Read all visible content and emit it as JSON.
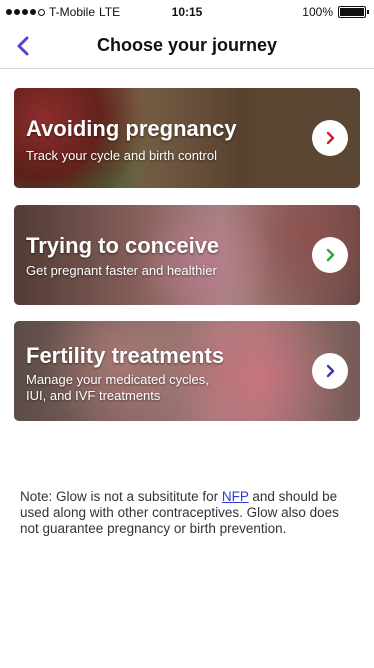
{
  "status": {
    "carrier": "T-Mobile",
    "network": "LTE",
    "time": "10:15",
    "battery": "100%",
    "battery_level": 1.0
  },
  "nav": {
    "back_icon": "chevron-left-icon",
    "title": "Choose your journey",
    "accent_color": "#5b3fd1"
  },
  "journeys": [
    {
      "title": "Avoiding pregnancy",
      "subtitle": "Track your cycle and birth control",
      "arrow_color": "#d0202a",
      "arrow_icon": "chevron-right-icon"
    },
    {
      "title": "Trying to conceive",
      "subtitle": "Get pregnant faster and healthier",
      "arrow_color": "#2da832",
      "arrow_icon": "chevron-right-icon"
    },
    {
      "title": "Fertility treatments",
      "subtitle_line1": "Manage your medicated cycles,",
      "subtitle_line2": "IUI, and IVF treatments",
      "arrow_color": "#4a2fb5",
      "arrow_icon": "chevron-right-icon"
    }
  ],
  "note": {
    "prefix": "Note: Glow is not a subsititute for ",
    "link": "NFP",
    "suffix": " and should be used along with other contraceptives. Glow also does not guarantee pregnancy or birth prevention."
  }
}
